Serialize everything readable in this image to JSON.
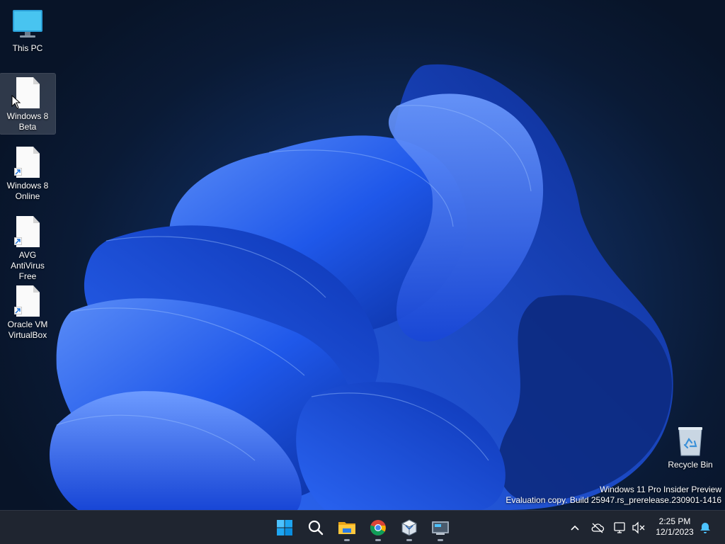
{
  "desktop_icons": [
    {
      "label": "This PC",
      "icon": "monitor-icon"
    },
    {
      "label": "Windows 8 Beta",
      "icon": "document-icon"
    },
    {
      "label": "Windows 8 Online",
      "icon": "document-shortcut-icon"
    },
    {
      "label": "AVG AntiVirus Free",
      "icon": "document-shortcut-icon"
    },
    {
      "label": "Oracle VM VirtualBox",
      "icon": "document-shortcut-icon"
    }
  ],
  "recycle_bin": {
    "label": "Recycle Bin",
    "icon": "recycle-bin-icon"
  },
  "watermark": {
    "line1": "Windows 11 Pro Insider Preview",
    "line2": "Evaluation copy. Build 25947.rs_prerelease.230901-1416"
  },
  "taskbar": {
    "pinned": [
      {
        "name": "Start",
        "icon": "windows-start-icon"
      },
      {
        "name": "Search",
        "icon": "search-icon"
      },
      {
        "name": "File Explorer",
        "icon": "folder-icon",
        "running": true
      },
      {
        "name": "Google Chrome",
        "icon": "chrome-icon",
        "running": true
      },
      {
        "name": "Oracle VM VirtualBox",
        "icon": "virtualbox-icon",
        "running": true
      },
      {
        "name": "Remote Desktop",
        "icon": "remote-desktop-icon",
        "running": true
      }
    ],
    "tray": {
      "icons": [
        "chevron-up-icon",
        "cloud-offline-icon",
        "network-icon",
        "volume-muted-icon",
        "notification-bell-icon"
      ],
      "time": "2:25 PM",
      "date": "12/1/2023"
    }
  },
  "colors": {
    "wallpaper_bg": "#0a1a35",
    "bloom_blue": "#1f5cf0",
    "taskbar_bg": "#1f2530",
    "accent": "#2b7de9"
  }
}
